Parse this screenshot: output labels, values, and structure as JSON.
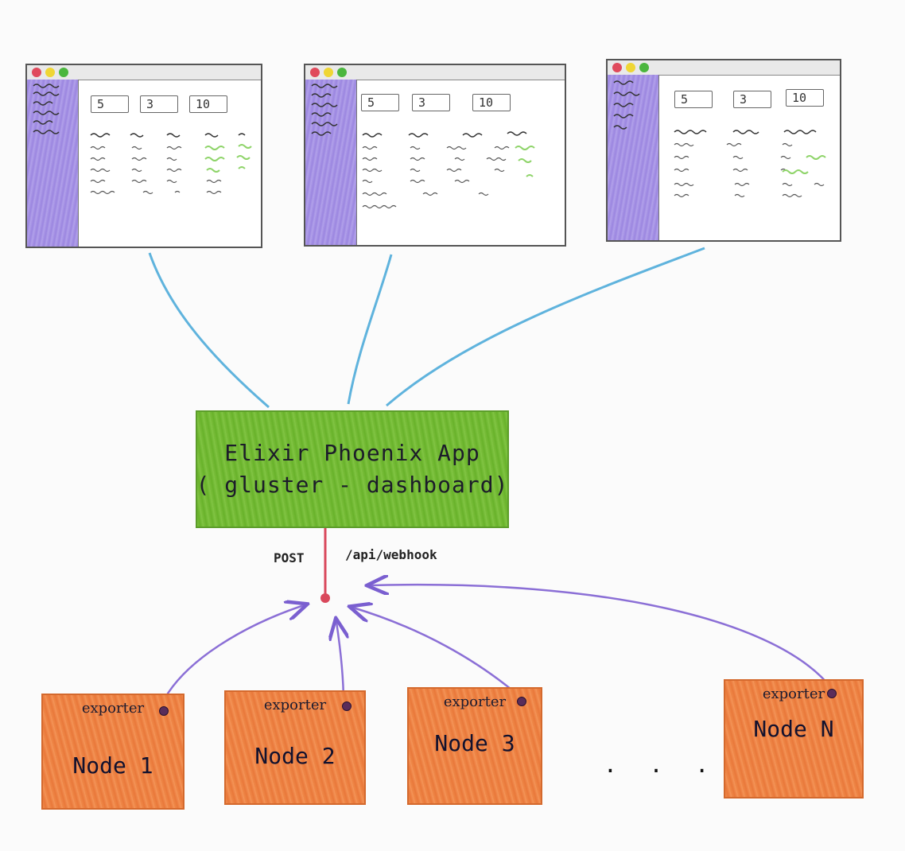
{
  "app": {
    "title_line1": "Elixir Phoenix App",
    "title_line2": "( gluster - dashboard)"
  },
  "endpoint": {
    "method": "POST",
    "path": "/api/webhook"
  },
  "browsers": [
    {
      "stats": [
        "5",
        "3",
        "10"
      ]
    },
    {
      "stats": [
        "5",
        "3",
        "10"
      ]
    },
    {
      "stats": [
        "5",
        "3",
        "10"
      ]
    }
  ],
  "nodes": [
    {
      "exporter_label": "exporter",
      "name": "Node 1"
    },
    {
      "exporter_label": "exporter",
      "name": "Node 2"
    },
    {
      "exporter_label": "exporter",
      "name": "Node 3"
    },
    {
      "exporter_label": "exporter",
      "name": "Node N"
    }
  ],
  "ellipsis": ". . .",
  "colors": {
    "browser_link": "#5fb3dd",
    "webhook_link": "#d9485b",
    "exporter_link": "#8b6fd6",
    "app_fill": "#6db52f",
    "node_fill": "#ef8543",
    "sidebar_fill": "#a996e6",
    "sparkline_green": "#8fd46a"
  }
}
